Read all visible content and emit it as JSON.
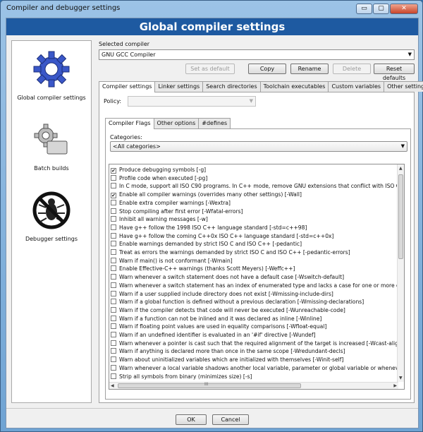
{
  "window": {
    "title": "Compiler and debugger settings",
    "minimize_glyph": "▭",
    "maximize_glyph": "▢",
    "close_glyph": "✕"
  },
  "banner": {
    "title": "Global compiler settings"
  },
  "nav": {
    "items": [
      {
        "label": "Global compiler settings",
        "icon": "gear-icon"
      },
      {
        "label": "Batch builds",
        "icon": "gears-icon"
      },
      {
        "label": "Debugger settings",
        "icon": "no-bug-icon"
      }
    ]
  },
  "compiler": {
    "label": "Selected compiler",
    "value": "GNU GCC Compiler",
    "buttons": {
      "set_default": "Set as default",
      "copy": "Copy",
      "rename": "Rename",
      "delete": "Delete",
      "reset": "Reset defaults"
    }
  },
  "tabs": [
    "Compiler settings",
    "Linker settings",
    "Search directories",
    "Toolchain executables",
    "Custom variables",
    "Other settings"
  ],
  "policy": {
    "label": "Policy:",
    "value": ""
  },
  "subtabs": [
    "Compiler Flags",
    "Other options",
    "#defines"
  ],
  "categories": {
    "label": "Categories:",
    "value": "<All categories>"
  },
  "flags": [
    {
      "text": "Produce debugging symbols  [-g]",
      "checked": true
    },
    {
      "text": "Profile code when executed  [-pg]",
      "checked": false
    },
    {
      "text": "In C mode, support all ISO C90 programs. In C++ mode, remove GNU extensions that conflict with ISO C+",
      "checked": false
    },
    {
      "text": "Enable all compiler warnings (overrides many other settings)  [-Wall]",
      "checked": true
    },
    {
      "text": "Enable extra compiler warnings  [-Wextra]",
      "checked": false
    },
    {
      "text": "Stop compiling after first error  [-Wfatal-errors]",
      "checked": false
    },
    {
      "text": "Inhibit all warning messages  [-w]",
      "checked": false
    },
    {
      "text": "Have g++ follow the 1998 ISO C++ language standard  [-std=c++98]",
      "checked": false
    },
    {
      "text": "Have g++ follow the coming C++0x ISO C++ language standard  [-std=c++0x]",
      "checked": false
    },
    {
      "text": "Enable warnings demanded by strict ISO C and ISO C++  [-pedantic]",
      "checked": false
    },
    {
      "text": "Treat as errors the warnings demanded by strict ISO C and ISO C++  [-pedantic-errors]",
      "checked": false
    },
    {
      "text": "Warn if main() is not conformant  [-Wmain]",
      "checked": false
    },
    {
      "text": "Enable Effective-C++ warnings (thanks Scott Meyers)  [-Weffc++]",
      "checked": false
    },
    {
      "text": "Warn whenever a switch statement does not have a default case  [-Wswitch-default]",
      "checked": false
    },
    {
      "text": "Warn whenever a switch statement has an index of enumerated type and lacks a case for one or more of t",
      "checked": false
    },
    {
      "text": "Warn if a user supplied include directory does not exist  [-Wmissing-include-dirs]",
      "checked": false
    },
    {
      "text": "Warn if a global function is defined without a previous declaration  [-Wmissing-declarations]",
      "checked": false
    },
    {
      "text": "Warn if the compiler detects that code will never be executed  [-Wunreachable-code]",
      "checked": false
    },
    {
      "text": "Warn if a function can not be inlined and it was declared as inline  [-Winline]",
      "checked": false
    },
    {
      "text": "Warn if floating point values are used in equality comparisons  [-Wfloat-equal]",
      "checked": false
    },
    {
      "text": "Warn if an undefined identifier is evaluated in an '#if' directive  [-Wundef]",
      "checked": false
    },
    {
      "text": "Warn whenever a pointer is cast such that the required alignment of the target is increased  [-Wcast-align]",
      "checked": false
    },
    {
      "text": "Warn if anything is declared more than once in the same scope  [-Wredundant-decls]",
      "checked": false
    },
    {
      "text": "Warn about uninitialized variables which are initialized with themselves  [-Winit-self]",
      "checked": false
    },
    {
      "text": "Warn whenever a local variable shadows another local variable, parameter or global variable or whenever",
      "checked": false
    },
    {
      "text": "Strip all symbols from binary (minimizes size)  [-s]",
      "checked": false
    }
  ],
  "hscroll_thumb_glyph": "III",
  "footer": {
    "ok": "OK",
    "cancel": "Cancel"
  }
}
